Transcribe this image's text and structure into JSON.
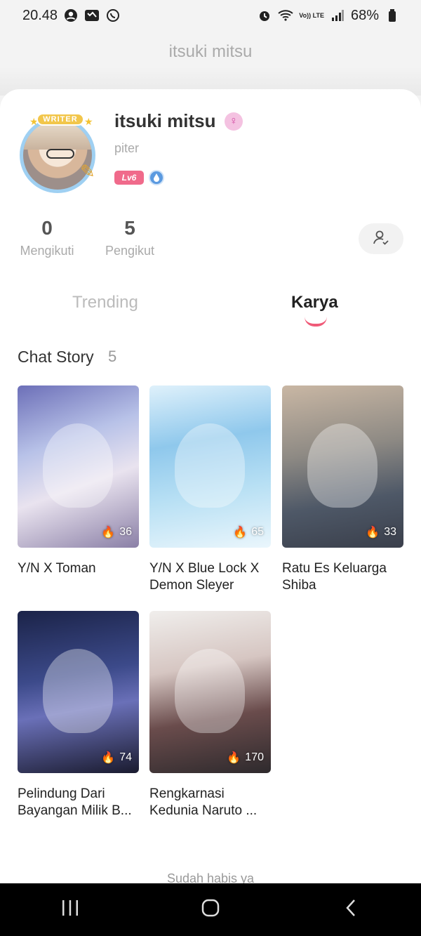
{
  "status_bar": {
    "time": "20.48",
    "battery": "68%",
    "network": "Vo)) LTE"
  },
  "header": {
    "title": "itsuki mitsu"
  },
  "profile": {
    "avatar_badge": "WRITER",
    "name": "itsuki mitsu",
    "user_id": "piter",
    "level": "Lv6",
    "stats": {
      "following_count": "0",
      "following_label": "Mengikuti",
      "followers_count": "5",
      "followers_label": "Pengikut"
    }
  },
  "tabs": [
    {
      "label": "Trending",
      "active": false
    },
    {
      "label": "Karya",
      "active": true
    }
  ],
  "section": {
    "title": "Chat Story",
    "count": "5"
  },
  "stories": [
    {
      "title": "Y/N X Toman",
      "views": "36"
    },
    {
      "title": "Y/N X Blue Lock X Demon Sleyer",
      "views": "65"
    },
    {
      "title": "Ratu Es Keluarga Shiba",
      "views": "33"
    },
    {
      "title": "Pelindung Dari Bayangan Milik B...",
      "views": "74"
    },
    {
      "title": "Rengkarnasi Kedunia Naruto ...",
      "views": "170"
    }
  ],
  "footer": {
    "end_text": "Sudah habis ya"
  },
  "colors": {
    "accent": "#f05a78",
    "level_badge": "#f06a8b"
  },
  "icons": [
    "alarm-icon",
    "wifi-icon",
    "signal-icon",
    "battery-icon",
    "female-icon",
    "drop-icon",
    "add-user-icon",
    "flame-icon",
    "recent-apps-icon",
    "home-icon",
    "back-icon"
  ]
}
